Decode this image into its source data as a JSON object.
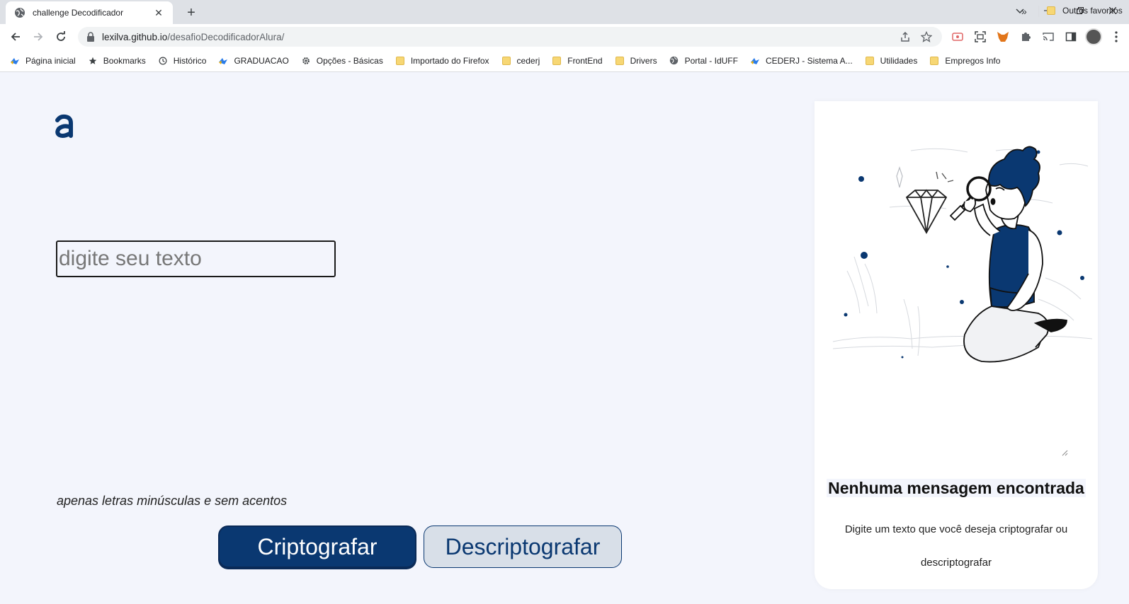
{
  "browser": {
    "tab_title": "challenge Decodificador",
    "url_host": "lexilva.github.io",
    "url_path": "/desafioDecodificadorAlura/",
    "bookmarks": [
      {
        "label": "Página inicial",
        "icon": "alura-icon"
      },
      {
        "label": "Bookmarks",
        "icon": "star-icon"
      },
      {
        "label": "Histórico",
        "icon": "history-icon"
      },
      {
        "label": "GRADUACAO",
        "icon": "alura-icon"
      },
      {
        "label": "Opções - Básicas",
        "icon": "gear-icon"
      },
      {
        "label": "Importado do Firefox",
        "icon": "folder-icon"
      },
      {
        "label": "cederj",
        "icon": "folder-icon"
      },
      {
        "label": "FrontEnd",
        "icon": "folder-icon"
      },
      {
        "label": "Drivers",
        "icon": "folder-icon"
      },
      {
        "label": "Portal - IdUFF",
        "icon": "globe-icon"
      },
      {
        "label": "CEDERJ - Sistema A...",
        "icon": "alura-icon"
      },
      {
        "label": "Utilidades",
        "icon": "folder-icon"
      },
      {
        "label": "Empregos Info",
        "icon": "folder-icon"
      }
    ],
    "bookmarks_more": "»",
    "other_bookmarks": "Outros favoritos"
  },
  "app": {
    "input_placeholder": "digite seu texto",
    "input_value": "",
    "hint": "apenas letras minúsculas e sem acentos",
    "encrypt_label": "Criptografar",
    "decrypt_label": "Descriptografar",
    "empty_title": "Nenhuma mensagem encontrada",
    "empty_desc": "Digite um texto que você deseja criptografar ou descriptografar"
  },
  "colors": {
    "primary": "#0a3871",
    "background": "#f3f5fc",
    "panel": "#ffffff",
    "secondary_button": "#d8dfe8"
  }
}
